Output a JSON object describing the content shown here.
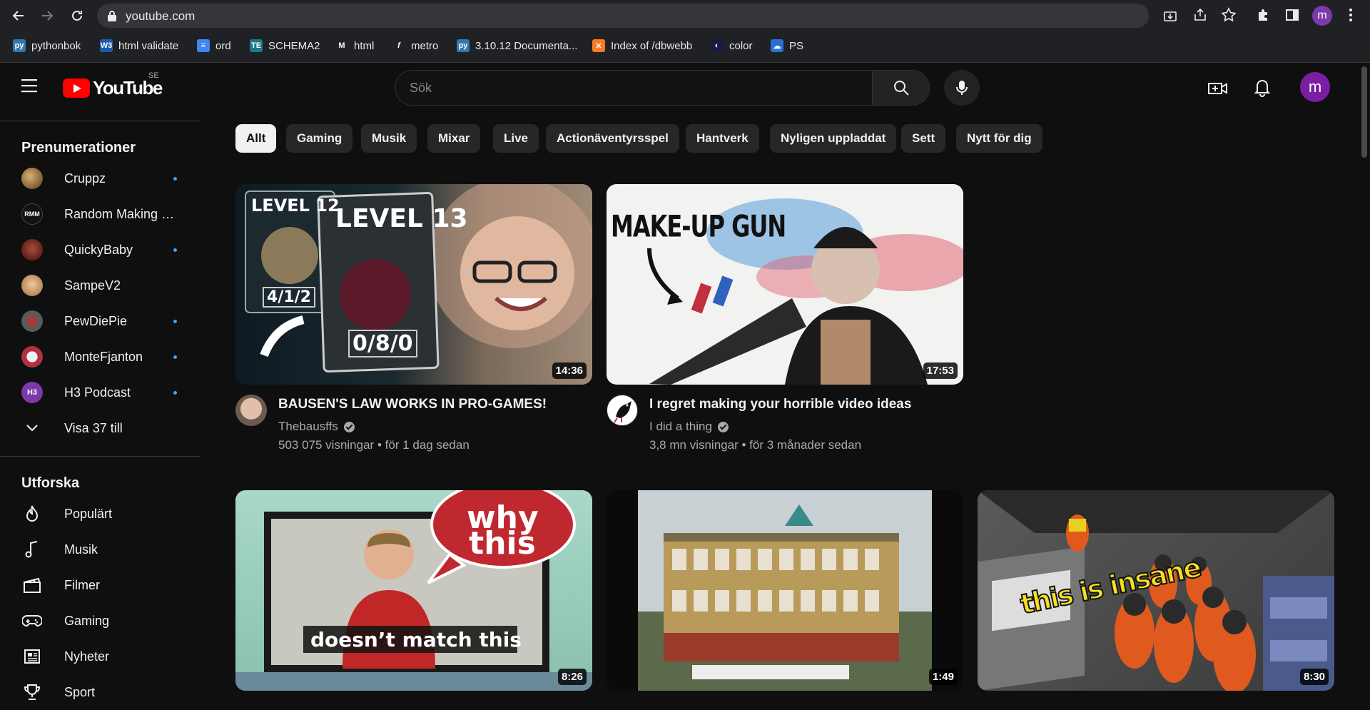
{
  "browser": {
    "url": "youtube.com",
    "bookmarks": [
      {
        "label": "pythonbok",
        "icon": "python-icon",
        "color": "#3776ab"
      },
      {
        "label": "html validate",
        "icon": "w3c-icon",
        "color": "#1b5caa"
      },
      {
        "label": "ord",
        "icon": "docs-icon",
        "color": "#4285f4"
      },
      {
        "label": "SCHEMA2",
        "icon": "te-icon",
        "color": "#1a7a8a"
      },
      {
        "label": "html",
        "icon": "m-icon",
        "color": "#222222"
      },
      {
        "label": "metro",
        "icon": "f-icon",
        "color": "#222222"
      },
      {
        "label": "3.10.12 Documenta...",
        "icon": "python-icon",
        "color": "#3776ab"
      },
      {
        "label": "Index of /dbwebb",
        "icon": "xampp-icon",
        "color": "#fb7a24"
      },
      {
        "label": "color",
        "icon": "color-icon",
        "color": "#1a1a40"
      },
      {
        "label": "PS",
        "icon": "ps-icon",
        "color": "#2a6fd6"
      }
    ],
    "profile_initial": "m"
  },
  "masthead": {
    "logo_text": "YouTube",
    "country_code": "SE",
    "search_placeholder": "Sök",
    "avatar_initial": "m"
  },
  "sidebar": {
    "subscriptions_title": "Prenumerationer",
    "subscriptions": [
      {
        "label": "Cruppz",
        "new": true,
        "color": "#8a6a3a"
      },
      {
        "label": "Random Making M...",
        "new": false,
        "color": "#111111"
      },
      {
        "label": "QuickyBaby",
        "new": true,
        "color": "#7a2a2a"
      },
      {
        "label": "SampeV2",
        "new": false,
        "color": "#c89a6a"
      },
      {
        "label": "PewDiePie",
        "new": true,
        "color": "#5a5a5a"
      },
      {
        "label": "MonteFjanton",
        "new": true,
        "color": "#b03040"
      },
      {
        "label": "H3 Podcast",
        "new": true,
        "color": "#7a3aa8"
      }
    ],
    "show_more_label": "Visa 37 till",
    "explore_title": "Utforska",
    "explore": [
      {
        "label": "Populärt",
        "icon": "flame-icon"
      },
      {
        "label": "Musik",
        "icon": "music-note-icon"
      },
      {
        "label": "Filmer",
        "icon": "clapperboard-icon"
      },
      {
        "label": "Gaming",
        "icon": "gamepad-icon"
      },
      {
        "label": "Nyheter",
        "icon": "newspaper-icon"
      },
      {
        "label": "Sport",
        "icon": "trophy-icon"
      }
    ]
  },
  "chips": [
    "Allt",
    "Gaming",
    "Musik",
    "Mixar",
    "Live",
    "Actionäventyrsspel",
    "Hantverk",
    "Nyligen uppladdat",
    "Sett",
    "Nytt för dig"
  ],
  "videos": [
    {
      "title": "BAUSEN'S LAW WORKS IN PRO-GAMES!",
      "channel": "Thebausffs",
      "verified": true,
      "views": "503 075 visningar",
      "age": "för 1 dag sedan",
      "duration": "14:36",
      "overlay": {
        "left_card_level": "LEVEL 12",
        "left_card_score": "4/1/2",
        "right_card_level": "LEVEL 13",
        "right_card_score": "0/8/0"
      }
    },
    {
      "title": "I regret making your horrible video ideas",
      "channel": "I did a thing",
      "verified": true,
      "views": "3,8 mn visningar",
      "age": "för 3 månader sedan",
      "duration": "17:53",
      "overlay": {
        "caption": "MAKE-UP GUN"
      }
    },
    {
      "duration": "8:26",
      "overlay": {
        "bubble_line1": "why",
        "bubble_line2": "this",
        "caption": "doesn’t match this"
      }
    },
    {
      "duration": "1:49"
    },
    {
      "duration": "8:30",
      "overlay": {
        "caption": "this is insane"
      }
    }
  ]
}
